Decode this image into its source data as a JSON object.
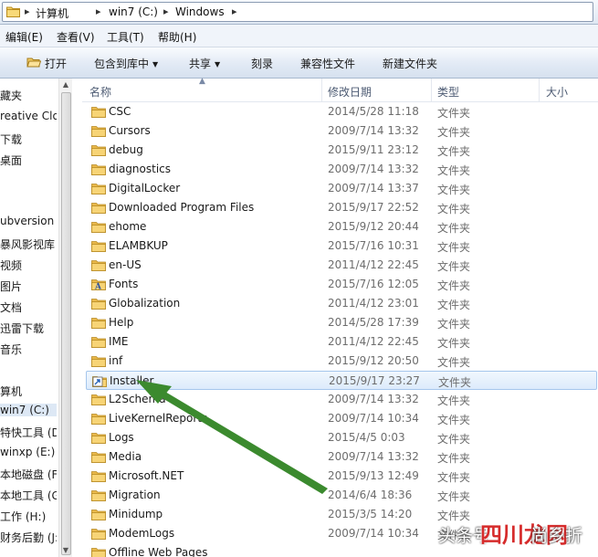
{
  "address": {
    "crumbs": [
      "计算机",
      "win7 (C:)",
      "Windows"
    ],
    "separator": "▸"
  },
  "menu": [
    "编辑(E)",
    "查看(V)",
    "工具(T)",
    "帮助(H)"
  ],
  "toolbar": {
    "open": "打开",
    "include_library": "包含到库中",
    "share": "共享",
    "burn": "刻录",
    "compatibility": "兼容性文件",
    "new_folder": "新建文件夹"
  },
  "nav": {
    "items": [
      "藏夹",
      "reative Clo",
      "下载",
      "桌面",
      "",
      "ubversion",
      "暴风影视库",
      "视频",
      "图片",
      "文档",
      "迅雷下载",
      "音乐",
      "",
      "算机",
      "win7 (C:)",
      "特快工具 (D:",
      "winxp (E:)",
      "本地磁盘 (F:)",
      "本地工具 (G:",
      "工作 (H:)",
      "财务后勤 (J:)"
    ],
    "selected_index": 14
  },
  "columns": {
    "name": "名称",
    "date": "修改日期",
    "type": "类型",
    "size": "大小"
  },
  "files": [
    {
      "name": "CSC",
      "date": "2014/5/28 11:18",
      "type": "文件夹",
      "icon": "folder-icon"
    },
    {
      "name": "Cursors",
      "date": "2009/7/14 13:32",
      "type": "文件夹",
      "icon": "folder-icon"
    },
    {
      "name": "debug",
      "date": "2015/9/11 23:12",
      "type": "文件夹",
      "icon": "folder-icon"
    },
    {
      "name": "diagnostics",
      "date": "2009/7/14 13:32",
      "type": "文件夹",
      "icon": "folder-icon"
    },
    {
      "name": "DigitalLocker",
      "date": "2009/7/14 13:37",
      "type": "文件夹",
      "icon": "folder-icon"
    },
    {
      "name": "Downloaded Program Files",
      "date": "2015/9/17 22:52",
      "type": "文件夹",
      "icon": "folder-icon"
    },
    {
      "name": "ehome",
      "date": "2015/9/12 20:44",
      "type": "文件夹",
      "icon": "folder-icon"
    },
    {
      "name": "ELAMBKUP",
      "date": "2015/7/16 10:31",
      "type": "文件夹",
      "icon": "folder-icon"
    },
    {
      "name": "en-US",
      "date": "2011/4/12 22:45",
      "type": "文件夹",
      "icon": "folder-icon"
    },
    {
      "name": "Fonts",
      "date": "2015/7/16 12:05",
      "type": "文件夹",
      "icon": "fonts-folder-icon"
    },
    {
      "name": "Globalization",
      "date": "2011/4/12 23:01",
      "type": "文件夹",
      "icon": "folder-icon"
    },
    {
      "name": "Help",
      "date": "2014/5/28 17:39",
      "type": "文件夹",
      "icon": "folder-icon"
    },
    {
      "name": "IME",
      "date": "2011/4/12 22:45",
      "type": "文件夹",
      "icon": "folder-icon"
    },
    {
      "name": "inf",
      "date": "2015/9/12 20:50",
      "type": "文件夹",
      "icon": "folder-icon"
    },
    {
      "name": "Installer",
      "date": "2015/9/17 23:27",
      "type": "文件夹",
      "icon": "installer-folder-icon"
    },
    {
      "name": "L2Schema",
      "date": "2009/7/14 13:32",
      "type": "文件夹",
      "icon": "folder-icon"
    },
    {
      "name": "LiveKernelReports",
      "date": "2009/7/14 10:34",
      "type": "文件夹",
      "icon": "folder-icon"
    },
    {
      "name": "Logs",
      "date": "2015/4/5 0:03",
      "type": "文件夹",
      "icon": "folder-icon"
    },
    {
      "name": "Media",
      "date": "2009/7/14 13:32",
      "type": "文件夹",
      "icon": "folder-icon"
    },
    {
      "name": "Microsoft.NET",
      "date": "2015/9/13 12:49",
      "type": "文件夹",
      "icon": "folder-icon"
    },
    {
      "name": "Migration",
      "date": "2014/6/4 18:36",
      "type": "文件夹",
      "icon": "folder-icon"
    },
    {
      "name": "Minidump",
      "date": "2015/3/5 14:20",
      "type": "文件夹",
      "icon": "folder-icon"
    },
    {
      "name": "ModemLogs",
      "date": "2009/7/14 10:34",
      "type": "文件夹",
      "icon": "folder-icon"
    },
    {
      "name": "Offline Web Pages",
      "date": "",
      "type": "",
      "icon": "folder-icon"
    }
  ],
  "selected_file_index": 14,
  "annotation_arrow_color": "#3b8a2e",
  "watermark": {
    "prefix": "头条号",
    "site": "四川龙网",
    "suffix": "尚乡折"
  }
}
